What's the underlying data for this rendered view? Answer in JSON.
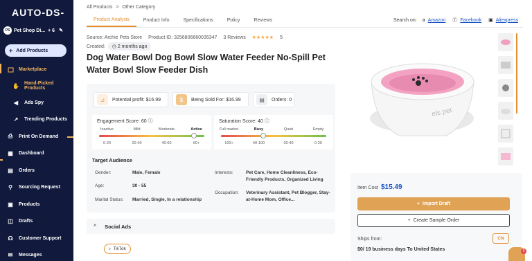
{
  "sidebar": {
    "logo": "AUTO-DS-",
    "store": {
      "initials": "PS",
      "name": "Pet Shop Di...",
      "extra": "+ 6"
    },
    "add_products": "Add Products",
    "items": [
      {
        "label": "Marketplace",
        "icon": "store-icon",
        "active": true
      },
      {
        "label": "Hand-Picked Products",
        "icon": "hand-icon",
        "active": true,
        "sub": true
      },
      {
        "label": "Ads Spy",
        "icon": "megaphone-icon",
        "sub": true
      },
      {
        "label": "Trending Products",
        "icon": "trend-icon",
        "sub": true
      },
      {
        "label": "Print On Demand",
        "icon": "print-icon"
      },
      {
        "label": "Dashboard",
        "icon": "dashboard-icon"
      },
      {
        "label": "Orders",
        "icon": "orders-icon"
      },
      {
        "label": "Sourcing Request",
        "icon": "sourcing-icon"
      },
      {
        "label": "Products",
        "icon": "box-icon"
      },
      {
        "label": "Drafts",
        "icon": "drafts-icon"
      },
      {
        "label": "Customer Support",
        "icon": "support-icon"
      },
      {
        "label": "Messages",
        "icon": "messages-icon"
      }
    ]
  },
  "breadcrumb": {
    "root": "All Products",
    "sep": ">",
    "current": "Other Category"
  },
  "tabs": [
    "Product Analysis",
    "Product Info",
    "Specifications",
    "Policy",
    "Reviews"
  ],
  "search_on": {
    "label": "Search on:",
    "amazon": "Amazon",
    "facebook": "Facebook",
    "aliexpress": "Aliexpress"
  },
  "meta": {
    "source": "Source: Archie Pets Store",
    "product_id": "Product ID: 3256806660035347",
    "reviews": "3 Reviews",
    "stars": "★★★★★",
    "rating": "5",
    "created_label": "Created:",
    "created_value": "2 months ago"
  },
  "title": "Dog Water Bowl Dog Bowl Slow Water Feeder No-Spill Pet Water Bowl Slow Feeder Dish",
  "kpis": {
    "profit": "Potential profit: $16.99",
    "sold_for": "Being Sold For: $16.99",
    "orders": "Orders: 0"
  },
  "engagement": {
    "label": "Engagement Score: 60",
    "categories": [
      "Inactive",
      "Mild",
      "Moderate",
      "Active"
    ],
    "ranges": [
      "0-20",
      "20-40",
      "40-60",
      "60+"
    ],
    "selected": 3,
    "level": 0.9
  },
  "saturation": {
    "label": "Saturation Score: 40",
    "categories": [
      "Full market",
      "Busy",
      "Quiet",
      "Empty"
    ],
    "ranges": [
      "100+",
      "40-100",
      "20-40",
      "0-20"
    ],
    "selected": 1,
    "level": 0.4
  },
  "target": {
    "heading": "Target Audience",
    "gender_label": "Gender:",
    "gender": "Male, Female",
    "age_label": "Age:",
    "age": "30 - 55",
    "marital_label": "Marital Status:",
    "marital": "Married, Single, In a relationship",
    "interests_label": "Interests:",
    "interests": "Pet Care, Home Cleanliness, Eco-Friendly Products, Organized Living",
    "occupation_label": "Occupation:",
    "occupation": "Veterinary Assistant, Pet Blogger, Stay-at-Home Mom, Office..."
  },
  "social": {
    "label": "Social Ads",
    "tiktok": "TikTok"
  },
  "product_image": {
    "brand": "els pet"
  },
  "purchase": {
    "item_cost_label": "Item Cost",
    "item_cost": "$15.49",
    "import": "Import Draft",
    "sample": "Create Sample Order",
    "ships_from": "Ships from:",
    "ships_info": "$0/ 19 business days",
    "ships_to": "To United States",
    "country": "CN"
  },
  "chat_badge": "2"
}
